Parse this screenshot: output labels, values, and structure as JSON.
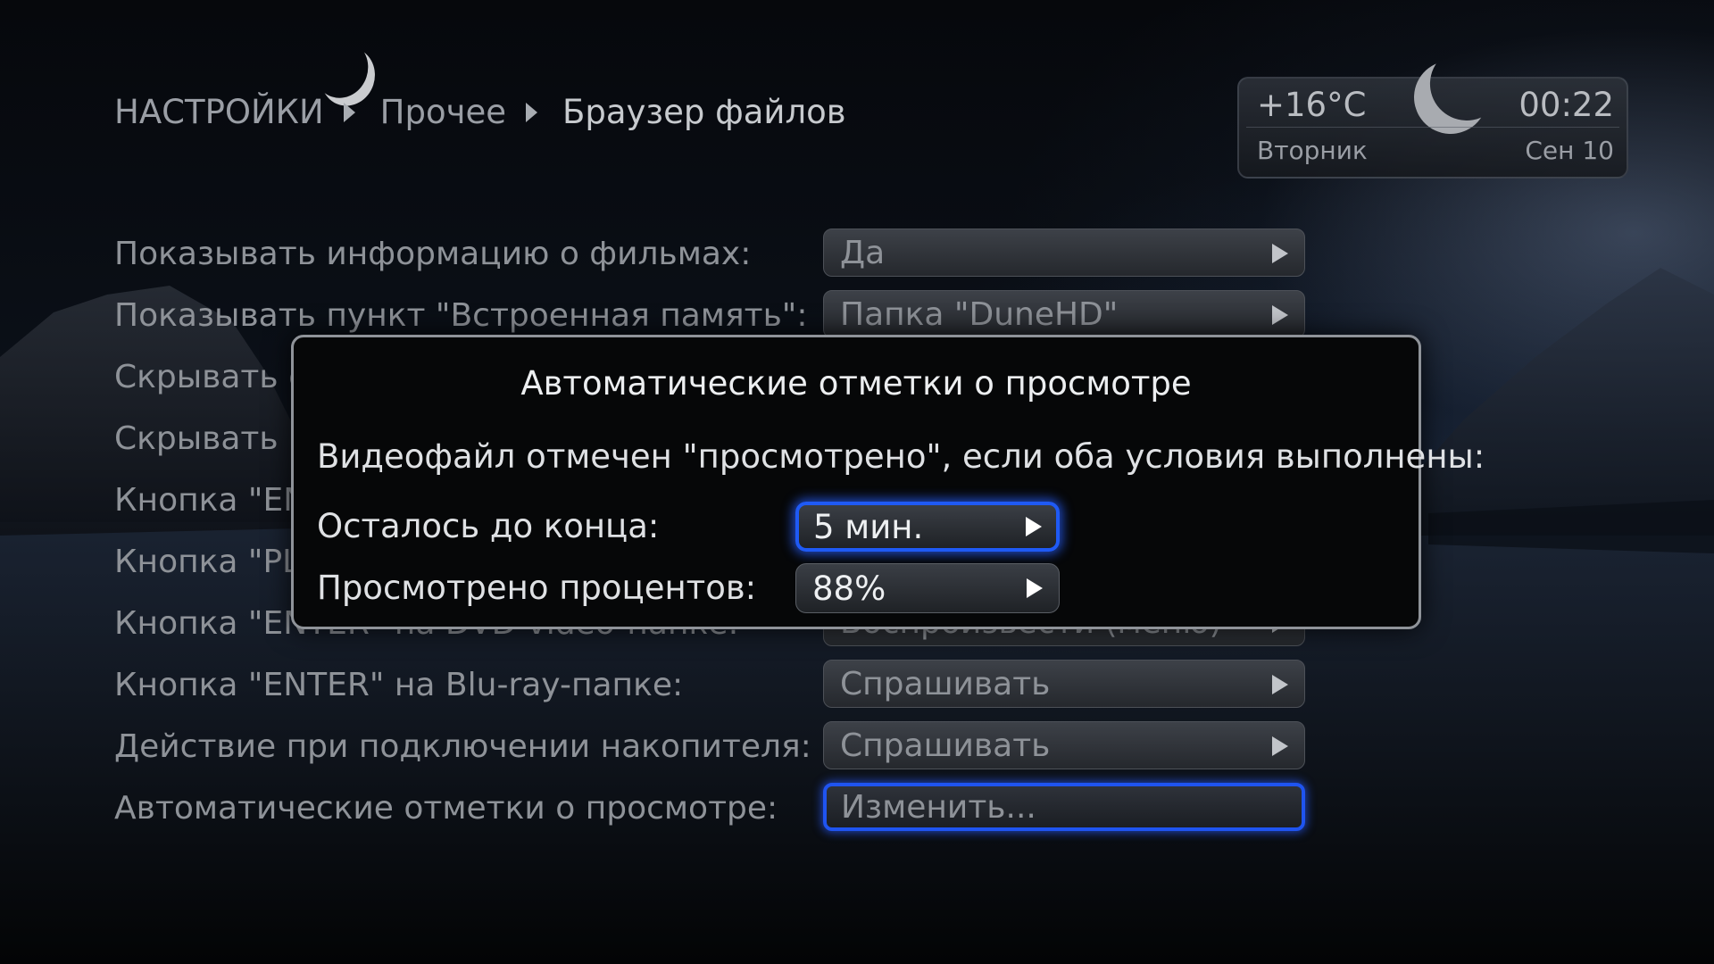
{
  "breadcrumb": {
    "items": [
      "НАСТРОЙКИ",
      "Прочее",
      "Браузер файлов"
    ]
  },
  "widget": {
    "temperature": "+16°C",
    "time": "00:22",
    "weekday": "Вторник",
    "date": "Сен 10",
    "weather_icon": "crescent-moon-icon"
  },
  "settings": {
    "rows": [
      {
        "label": "Показывать информацию о фильмах:",
        "value": "Да"
      },
      {
        "label": "Показывать пункт \"Встроенная память\":",
        "value": "Папка \"DuneHD\""
      },
      {
        "label": "Скрывать с",
        "value": ""
      },
      {
        "label": "Скрывать п",
        "value": ""
      },
      {
        "label": "Кнопка \"EN",
        "value": ""
      },
      {
        "label": "Кнопка \"PL",
        "value": ""
      },
      {
        "label": "Кнопка \"ENTER\" на DVD-video-папке:",
        "value": "Воспроизвести (меню)"
      },
      {
        "label": "Кнопка \"ENTER\" на Blu-ray-папке:",
        "value": "Спрашивать"
      },
      {
        "label": "Действие при подключении накопителя:",
        "value": "Спрашивать"
      },
      {
        "label": "Автоматические отметки о просмотре:",
        "value": "Изменить..."
      }
    ]
  },
  "dialog": {
    "title": "Автоматические отметки о просмотре",
    "description": "Видеофайл отмечен \"просмотрено\", если оба условия выполнены:",
    "remaining_label": "Осталось до конца:",
    "remaining_value": "5 мин.",
    "percent_label": "Просмотрено процентов:",
    "percent_value": "88%"
  },
  "colors": {
    "focus": "#1f54f0",
    "text_dim": "#8e9298",
    "text_bright": "#eceef0"
  }
}
